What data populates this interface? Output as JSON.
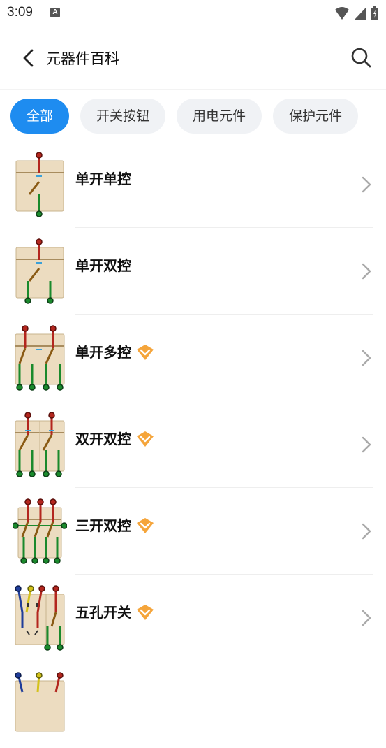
{
  "status_bar": {
    "time": "3:09",
    "notification_icon_letter": "A"
  },
  "header": {
    "title": "元器件百科",
    "back_icon": "chevron-left-icon",
    "search_icon": "search-icon"
  },
  "tabs": [
    {
      "label": "全部",
      "active": true
    },
    {
      "label": "开关按钮",
      "active": false
    },
    {
      "label": "用电元件",
      "active": false
    },
    {
      "label": "保护元件",
      "active": false
    }
  ],
  "items": [
    {
      "name": "单开单控",
      "vip": false
    },
    {
      "name": "单开双控",
      "vip": false
    },
    {
      "name": "单开多控",
      "vip": true
    },
    {
      "name": "双开双控",
      "vip": true
    },
    {
      "name": "三开双控",
      "vip": true
    },
    {
      "name": "五孔开关",
      "vip": true
    }
  ],
  "colors": {
    "accent": "#1e8cf0",
    "tab_bg": "#f0f2f5",
    "vip_badge": "#f5a53b",
    "panel": "#ecdcc0",
    "wire_live": "#b3261e",
    "wire_neutral": "#1a8a2c",
    "wire_switch": "#8a5a14"
  }
}
